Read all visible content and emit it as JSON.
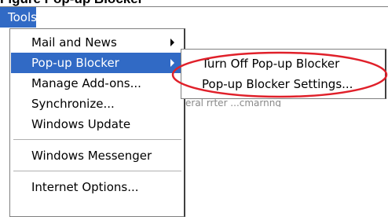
{
  "caption": {
    "text": "Figure   Pop-up Blocker"
  },
  "menubar": {
    "tools_label": "Tools"
  },
  "tools_menu": {
    "items": [
      {
        "label": "Mail and News",
        "has_submenu": true
      },
      {
        "label": "Pop-up Blocker",
        "has_submenu": true,
        "active": true
      },
      {
        "label": "Manage Add-ons..."
      },
      {
        "label": "Synchronize..."
      },
      {
        "label": "Windows Update"
      },
      {
        "label": "Windows Messenger"
      },
      {
        "label": "Internet Options..."
      }
    ]
  },
  "popup_blocker_submenu": {
    "items": [
      {
        "label": "Turn Off Pop-up Blocker"
      },
      {
        "label": "Pop-up Blocker Settings..."
      }
    ]
  },
  "background_fragment": "eral  rrter  ...cmarnng",
  "colors": {
    "selection": "#316ac5",
    "callout_ellipse": "#e0202a"
  }
}
